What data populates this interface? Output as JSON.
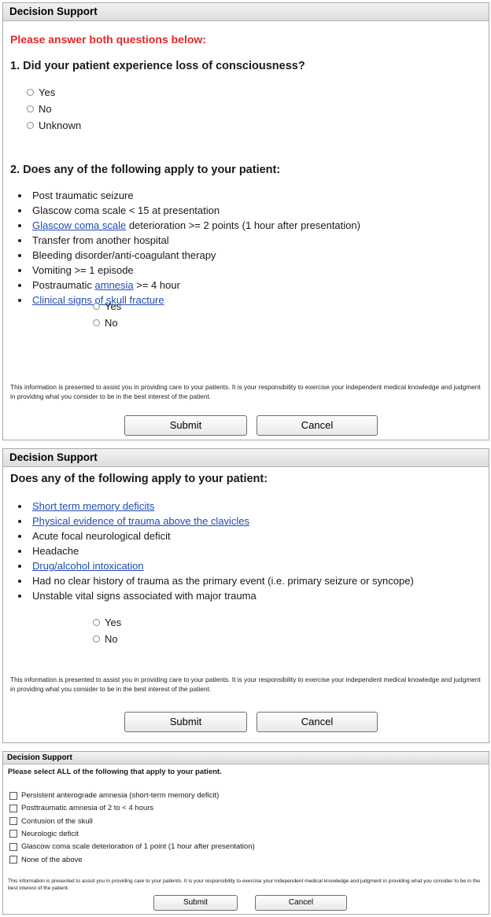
{
  "panel1": {
    "title": "Decision Support",
    "instruction": "Please answer both questions below:",
    "q1": "1. Did your patient experience loss of consciousness?",
    "q1_options": [
      "Yes",
      "No",
      "Unknown"
    ],
    "q2": "2. Does any of the following apply to your patient:",
    "items": [
      {
        "segments": [
          {
            "text": "Post traumatic seizure"
          }
        ]
      },
      {
        "segments": [
          {
            "text": "Glascow coma scale < 15 at presentation"
          }
        ]
      },
      {
        "segments": [
          {
            "text": "Glascow coma scale",
            "link": true
          },
          {
            "text": " deterioration >= 2 points (1 hour after presentation)"
          }
        ]
      },
      {
        "segments": [
          {
            "text": "Transfer from another hospital"
          }
        ]
      },
      {
        "segments": [
          {
            "text": "Bleeding disorder/anti-coagulant therapy"
          }
        ]
      },
      {
        "segments": [
          {
            "text": "Vomiting >= 1 episode"
          }
        ]
      },
      {
        "segments": [
          {
            "text": "Postraumatic "
          },
          {
            "text": "amnesia",
            "link": true
          },
          {
            "text": " >= 4 hour"
          }
        ]
      },
      {
        "segments": [
          {
            "text": "Clinical signs of skull fracture",
            "link": true
          }
        ]
      }
    ],
    "q2_options": [
      "Yes",
      "No"
    ],
    "disclaimer": "This information is presented to assist you in providing care to your patients. It is your responsibility to exercise your independent medical knowledge and judgment in providing what you consider to be in the best interest of the patient.",
    "submit": "Submit",
    "cancel": "Cancel"
  },
  "panel2": {
    "title": "Decision Support",
    "question": "Does any of the following apply to your patient:",
    "items": [
      {
        "segments": [
          {
            "text": "Short term memory deficits",
            "link": true
          }
        ]
      },
      {
        "segments": [
          {
            "text": "Physical evidence of trauma above the clavicles",
            "link": true
          }
        ]
      },
      {
        "segments": [
          {
            "text": "Acute focal neurological deficit"
          }
        ]
      },
      {
        "segments": [
          {
            "text": "Headache"
          }
        ]
      },
      {
        "segments": [
          {
            "text": "Drug/alcohol intoxication",
            "link": true
          }
        ]
      },
      {
        "segments": [
          {
            "text": "Had no clear history of trauma as the primary event (i.e. primary seizure or syncope)"
          }
        ]
      },
      {
        "segments": [
          {
            "text": "Unstable vital signs associated with major trauma"
          }
        ]
      }
    ],
    "options": [
      "Yes",
      "No"
    ],
    "disclaimer": "This information is presented to assist you in providing care to your patients. It is your responsibility to exercise your independent medical knowledge and judgment in providing what you consider to be in the best interest of the patient.",
    "submit": "Submit",
    "cancel": "Cancel"
  },
  "panel3": {
    "title": "Decision Support",
    "instruction": "Please select ALL of the following that apply to your patient.",
    "checks": [
      "Persistent anterograde amnesia (short-term memory deficit)",
      "Posttraumatic amnesia of 2 to < 4 hours",
      "Contusion of the skull",
      "Neurologic deficit",
      "Glascow coma scale deterioration of 1 point (1 hour after presentation)",
      "None of the above"
    ],
    "disclaimer": "This information is presented to assist you in providing care to your patients. It is your responsibility to exercise your independent medical knowledge and judgment in providing what you consider to be in the best interest of the patient.",
    "submit": "Submit",
    "cancel": "Cancel"
  }
}
